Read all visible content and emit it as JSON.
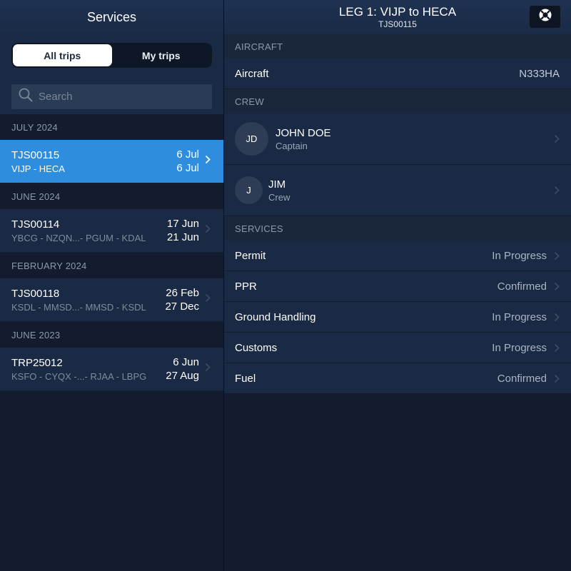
{
  "left": {
    "title": "Services",
    "tabs": [
      {
        "label": "All trips",
        "active": true
      },
      {
        "label": "My trips",
        "active": false
      }
    ],
    "search": {
      "placeholder": "Search",
      "value": ""
    },
    "groups": [
      {
        "header": "JULY 2024",
        "trips": [
          {
            "id": "TJS00115",
            "route": "VIJP - HECA",
            "date_start": "6 Jul",
            "date_end": "6 Jul",
            "selected": true
          }
        ]
      },
      {
        "header": "JUNE 2024",
        "trips": [
          {
            "id": "TJS00114",
            "route": "YBCG - NZQN...- PGUM - KDAL",
            "date_start": "17 Jun",
            "date_end": "21 Jun",
            "selected": false
          }
        ]
      },
      {
        "header": "FEBRUARY 2024",
        "trips": [
          {
            "id": "TJS00118",
            "route": "KSDL - MMSD...- MMSD - KSDL",
            "date_start": "26 Feb",
            "date_end": "27 Dec",
            "selected": false
          }
        ]
      },
      {
        "header": "JUNE 2023",
        "trips": [
          {
            "id": "TRP25012",
            "route": "KSFO - CYQX -...- RJAA - LBPG",
            "date_start": "6 Jun",
            "date_end": "27 Aug",
            "selected": false
          }
        ]
      }
    ]
  },
  "right": {
    "title": "LEG 1: VIJP to HECA",
    "subtitle": "TJS00115",
    "help_icon": "lifebuoy-icon",
    "aircraft_section": "AIRCRAFT",
    "aircraft": {
      "label": "Aircraft",
      "value": "N333HA"
    },
    "crew_section": "CREW",
    "crew": [
      {
        "initials": "JD",
        "name": "JOHN DOE",
        "role": "Captain"
      },
      {
        "initials": "J",
        "name": "JIM",
        "role": "Crew"
      }
    ],
    "services_section": "SERVICES",
    "services": [
      {
        "label": "Permit",
        "status": "In Progress"
      },
      {
        "label": "PPR",
        "status": "Confirmed"
      },
      {
        "label": "Ground Handling",
        "status": "In Progress"
      },
      {
        "label": "Customs",
        "status": "In Progress"
      },
      {
        "label": "Fuel",
        "status": "Confirmed"
      }
    ]
  },
  "colors": {
    "selected": "#2f8de0",
    "background": "#121c2e",
    "row": "#1a2a44"
  }
}
